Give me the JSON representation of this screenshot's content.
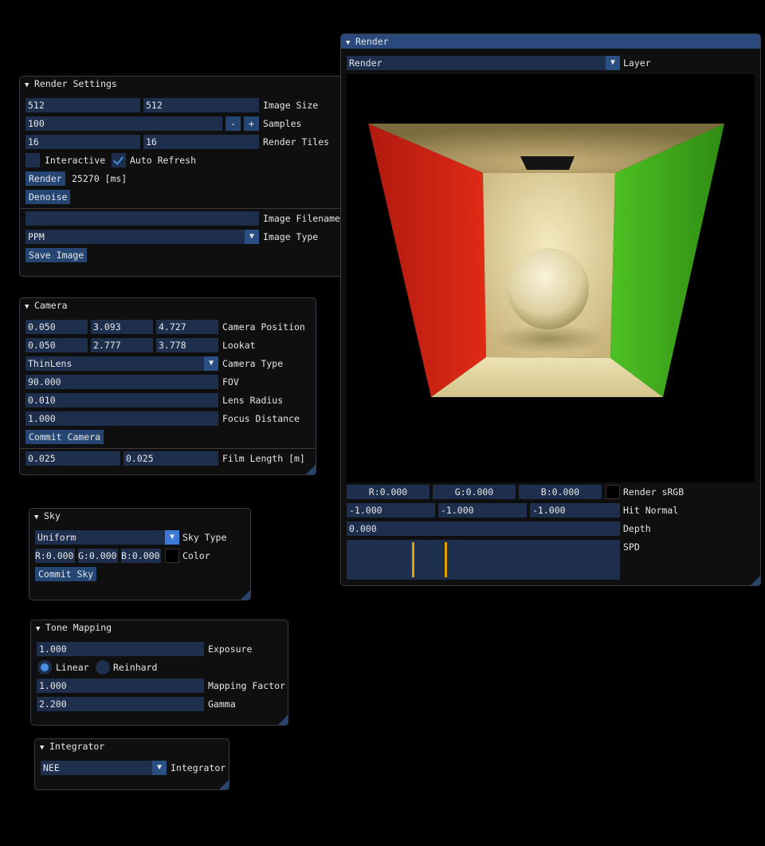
{
  "render_settings": {
    "title": "Render Settings",
    "image_width": "512",
    "image_height": "512",
    "image_size_label": "Image Size",
    "samples": "100",
    "minus": "-",
    "plus": "+",
    "samples_label": "Samples",
    "tiles_x": "16",
    "tiles_y": "16",
    "tiles_label": "Render Tiles",
    "interactive_label": "Interactive",
    "interactive_checked": false,
    "auto_refresh_label": "Auto Refresh",
    "auto_refresh_checked": true,
    "render_button": "Render",
    "render_time": "25270 [ms]",
    "denoise_button": "Denoise",
    "filename_value": "",
    "filename_label": "Image Filename",
    "image_type_value": "PPM",
    "image_type_label": "Image Type",
    "save_button": "Save Image"
  },
  "camera": {
    "title": "Camera",
    "position": [
      "0.050",
      "3.093",
      "4.727"
    ],
    "position_label": "Camera Position",
    "lookat": [
      "0.050",
      "2.777",
      "3.778"
    ],
    "lookat_label": "Lookat",
    "type_value": "ThinLens",
    "type_label": "Camera Type",
    "fov": "90.000",
    "fov_label": "FOV",
    "lens_radius": "0.010",
    "lens_radius_label": "Lens Radius",
    "focus_distance": "1.000",
    "focus_distance_label": "Focus Distance",
    "commit_button": "Commit Camera",
    "film_length": [
      "0.025",
      "0.025"
    ],
    "film_length_label": "Film Length [m]"
  },
  "sky": {
    "title": "Sky",
    "type_value": "Uniform",
    "type_label": "Sky Type",
    "r": "R:0.000",
    "g": "G:0.000",
    "b": "B:0.000",
    "color_label": "Color",
    "color_swatch": "#000000",
    "commit_button": "Commit Sky"
  },
  "tone_mapping": {
    "title": "Tone Mapping",
    "exposure": "1.000",
    "exposure_label": "Exposure",
    "linear_label": "Linear",
    "reinhard_label": "Reinhard",
    "selected": "Linear",
    "mapping_factor": "1.000",
    "mapping_factor_label": "Mapping Factor",
    "gamma": "2.200",
    "gamma_label": "Gamma"
  },
  "integrator": {
    "title": "Integrator",
    "value": "NEE",
    "label": "Integrator"
  },
  "render_window": {
    "title": "Render",
    "layer_value": "Render",
    "layer_label": "Layer",
    "pixel_r": "R:0.000",
    "pixel_g": "G:0.000",
    "pixel_b": "B:0.000",
    "render_srgb_label": "Render sRGB",
    "hit_normal": [
      "-1.000",
      "-1.000",
      "-1.000"
    ],
    "hit_normal_label": "Hit Normal",
    "depth": "0.000",
    "depth_label": "Depth",
    "spd_label": "SPD",
    "spd_markers": [
      0.24,
      0.36
    ]
  },
  "colors": {
    "title_active": "#294a7a",
    "field_bg": "#1d2f4d",
    "button_bg": "#254673",
    "accent": "#4a8ee0",
    "spd_line": "#e0a000"
  }
}
